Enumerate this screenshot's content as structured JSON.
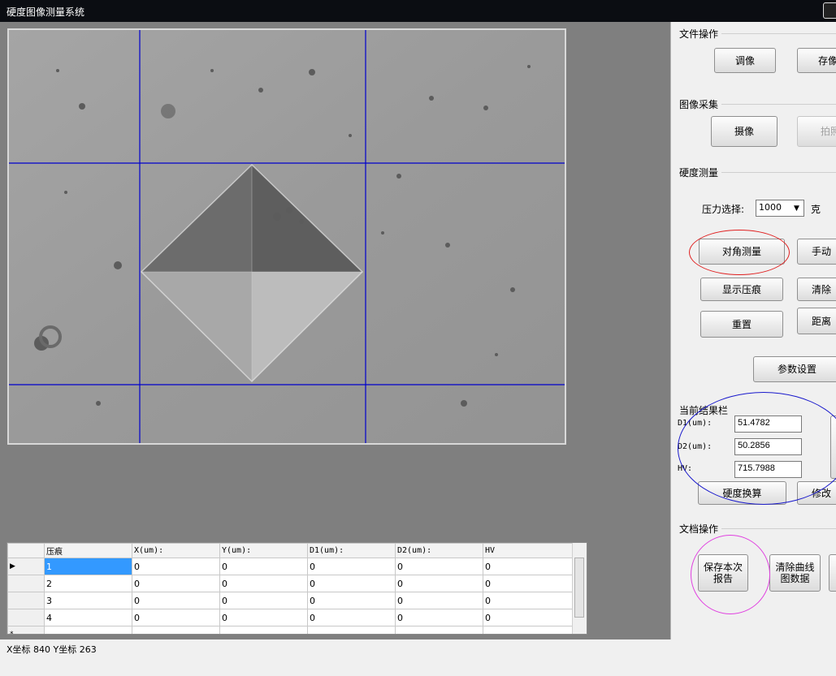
{
  "window": {
    "title": "硬度图像测量系统"
  },
  "file_ops": {
    "title": "文件操作",
    "adjust_label": "调像",
    "save_image_label": "存像"
  },
  "capture": {
    "title": "图像采集",
    "camera_label": "摄像",
    "photo_label": "拍照"
  },
  "measure": {
    "title": "硬度测量",
    "pressure_label": "压力选择:",
    "pressure_value": "1000",
    "pressure_unit": "克",
    "diagonal_label": "对角测量",
    "manual_label": "手动",
    "show_indent_label": "显示压痕",
    "clear_label": "清除",
    "reset_label": "重置",
    "distance_label": "距离",
    "params_label": "参数设置"
  },
  "results": {
    "title": "当前结果栏",
    "d1_label": "D1(um):",
    "d1_value": "51.4782",
    "d2_label": "D2(um):",
    "d2_value": "50.2856",
    "hv_label": "HV:",
    "hv_value": "715.7988",
    "convert_label": "硬度换算",
    "modify_label": "修改"
  },
  "doc_ops": {
    "title": "文档操作",
    "save_report_line1": "保存本次",
    "save_report_line2": "报告",
    "clear_curve_line1": "清除曲线",
    "clear_curve_line2": "图数据"
  },
  "table": {
    "columns": [
      "压痕",
      "X(um):",
      "Y(um):",
      "D1(um):",
      "D2(um):",
      "HV"
    ],
    "rows": [
      [
        "1",
        "0",
        "0",
        "0",
        "0",
        "0"
      ],
      [
        "2",
        "0",
        "0",
        "0",
        "0",
        "0"
      ],
      [
        "3",
        "0",
        "0",
        "0",
        "0",
        "0"
      ],
      [
        "4",
        "0",
        "0",
        "0",
        "0",
        "0"
      ]
    ],
    "new_row_marker": "*",
    "current_row_marker": "▶"
  },
  "status": {
    "text": "X坐标 840 Y坐标 263"
  },
  "colors": {
    "crosshair": "#0000cc",
    "red_ring": "#e02020",
    "blue_ring": "#1a1acc",
    "magenta_ring": "#e040e0"
  }
}
